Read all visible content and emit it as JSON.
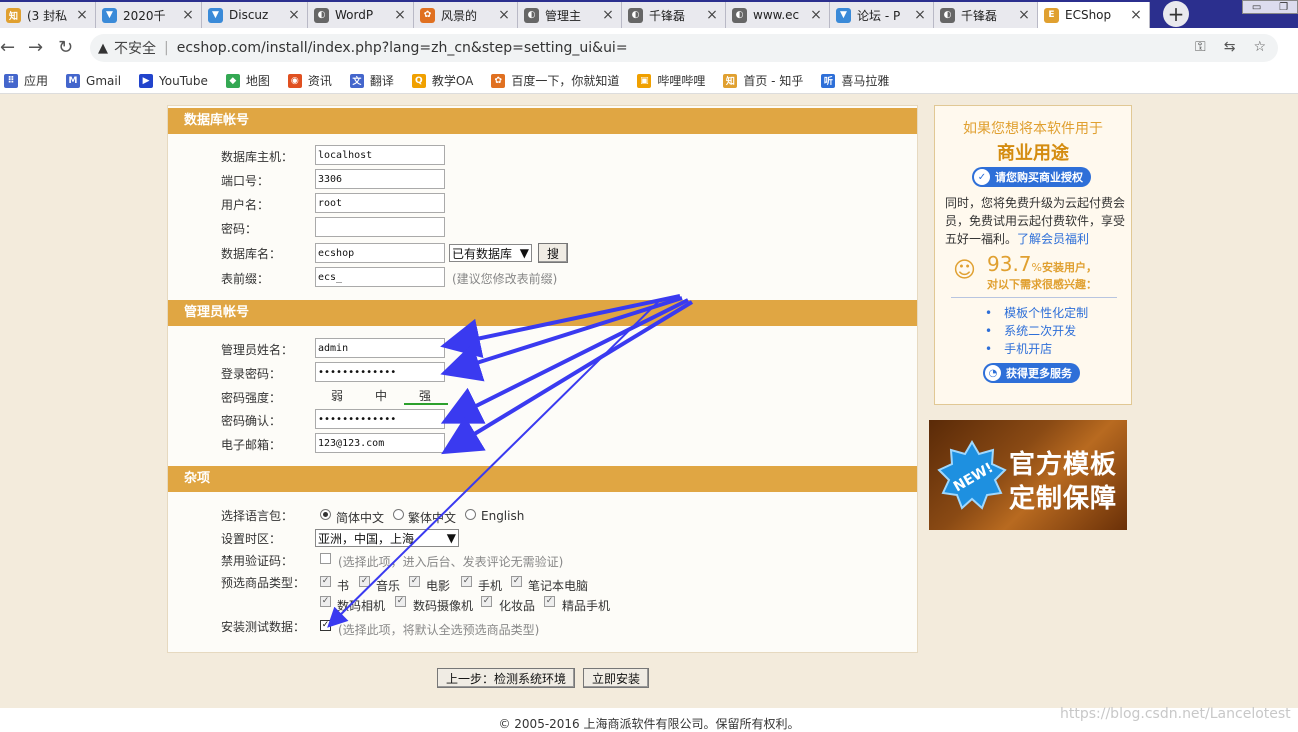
{
  "browser": {
    "tabs": [
      {
        "label": "(3 封私",
        "color": "#e0a030",
        "glyph": "知"
      },
      {
        "label": "2020千",
        "color": "#3a8ad8",
        "glyph": "▼"
      },
      {
        "label": "Discuz",
        "color": "#3a8ad8",
        "glyph": "▼"
      },
      {
        "label": "WordP",
        "color": "#666666",
        "glyph": "◐"
      },
      {
        "label": "风景的",
        "color": "#e07020",
        "glyph": "✿"
      },
      {
        "label": "管理主",
        "color": "#666666",
        "glyph": "◐"
      },
      {
        "label": "千锋磊",
        "color": "#666666",
        "glyph": "◐"
      },
      {
        "label": "www.ec",
        "color": "#666666",
        "glyph": "◐"
      },
      {
        "label": "论坛 - P",
        "color": "#3a8ad8",
        "glyph": "▼"
      },
      {
        "label": "千锋磊",
        "color": "#666666",
        "glyph": "◐"
      },
      {
        "label": "ECShop",
        "color": "#e0a030",
        "glyph": "E"
      }
    ],
    "new_tab": "+",
    "insecure_label": "不安全",
    "url": "ecshop.com/install/index.php?lang=zh_cn&step=setting_ui&ui=",
    "bookmarks": [
      {
        "label": "应用",
        "color": "#4466cc",
        "glyph": "⠿"
      },
      {
        "label": "Gmail",
        "color": "#4466cc",
        "glyph": "M"
      },
      {
        "label": "YouTube",
        "color": "#2244cc",
        "glyph": "▶"
      },
      {
        "label": "地图",
        "color": "#34a853",
        "glyph": "◆"
      },
      {
        "label": "资讯",
        "color": "#e05020",
        "glyph": "◉"
      },
      {
        "label": "翻译",
        "color": "#4466cc",
        "glyph": "文"
      },
      {
        "label": "教学OA",
        "color": "#f0a000",
        "glyph": "Q"
      },
      {
        "label": "百度一下，你就知道",
        "color": "#e07020",
        "glyph": "✿"
      },
      {
        "label": "哔哩哔哩",
        "color": "#f0a000",
        "glyph": "▣"
      },
      {
        "label": "首页 - 知乎",
        "color": "#e0a030",
        "glyph": "知"
      },
      {
        "label": "喜马拉雅",
        "color": "#2e6fd8",
        "glyph": "听"
      }
    ]
  },
  "form": {
    "db_section": "数据库帐号",
    "db_host_label": "数据库主机：",
    "db_host": "localhost",
    "db_port_label": "端口号：",
    "db_port": "3306",
    "db_user_label": "用户名：",
    "db_user": "root",
    "db_pass_label": "密码：",
    "db_pass": "",
    "db_name_label": "数据库名：",
    "db_name": "ecshop",
    "db_exist_select": "已有数据库",
    "search_btn": "搜",
    "prefix_label": "表前缀：",
    "prefix": "ecs_",
    "prefix_hint": "(建议您修改表前缀)",
    "admin_section": "管理员帐号",
    "admin_name_label": "管理员姓名：",
    "admin_name": "admin",
    "admin_pass_label": "登录密码：",
    "admin_pass": "•••••••••••••",
    "strength_label": "密码强度：",
    "strength_weak": "弱",
    "strength_mid": "中",
    "strength_strong": "强",
    "confirm_label": "密码确认：",
    "confirm_pass": "•••••••••••••",
    "email_label": "电子邮箱：",
    "email": "123@123.com",
    "misc_section": "杂项",
    "lang_label": "选择语言包：",
    "lang_simplified": "简体中文",
    "lang_traditional": "繁体中文",
    "lang_english": "English",
    "tz_label": "设置时区：",
    "tz_value": "亚洲，中国，上海",
    "captcha_label": "禁用验证码：",
    "captcha_hint": "(选择此项，进入后台、发表评论无需验证)",
    "goods_label": "预选商品类型：",
    "goods": [
      "书",
      "音乐",
      "电影",
      "手机",
      "笔记本电脑",
      "数码相机",
      "数码摄像机",
      "化妆品",
      "精品手机"
    ],
    "testdata_label": "安装测试数据：",
    "testdata_hint": "(选择此项，将默认全选预选商品类型)",
    "prev_btn": "上一步：检测系统环境",
    "install_btn": "立即安装"
  },
  "promo": {
    "line1": "如果您想将本软件用于",
    "line2": "商业用途",
    "buy_btn": "请您购买商业授权",
    "desc": "同时，您将免费升级为云起付费会员，免费试用云起付费软件，享受五好一福利。",
    "desc_link": "了解会员福利",
    "stat_value": "93.7",
    "stat_unit": "%",
    "stat_label": "安装用户，",
    "interest": "对以下需求很感兴趣：",
    "items": [
      "模板个性化定制",
      "系统二次开发",
      "手机开店"
    ],
    "more_btn": "获得更多服务",
    "banner_new": "NEW!",
    "banner_line1": "官方模板",
    "banner_line2": "定制保障"
  },
  "footer": {
    "copyright": "© 2005-2016 上海商派软件有限公司。保留所有权利。",
    "watermark": "https://blog.csdn.net/Lancelotest"
  }
}
